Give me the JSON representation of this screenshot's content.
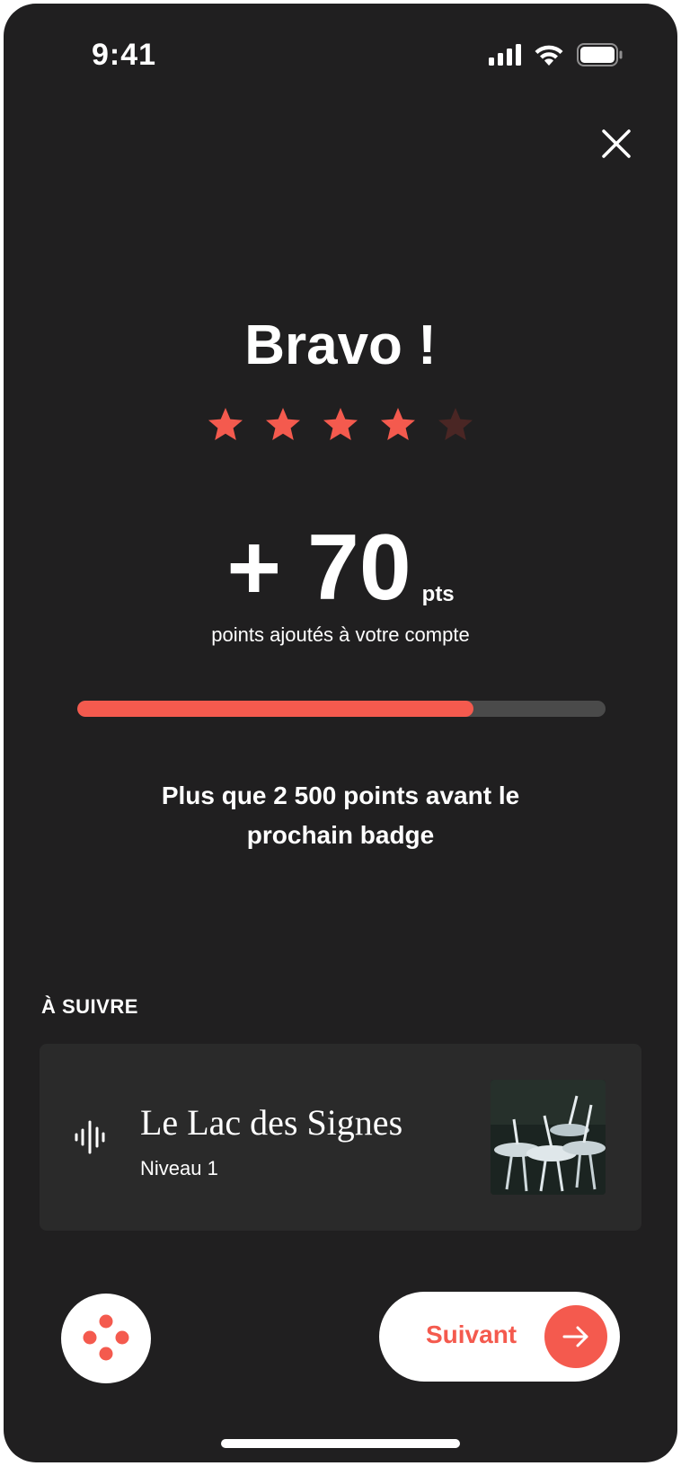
{
  "status_bar": {
    "time": "9:41",
    "icons": [
      "signal-icon",
      "wifi-icon",
      "battery-icon"
    ]
  },
  "header": {
    "close_icon": "close-icon"
  },
  "result": {
    "title": "Bravo !",
    "rating": 4,
    "rating_max": 5,
    "points_value": "+ 70",
    "points_unit": "pts",
    "points_caption": "points ajoutés à votre compte",
    "progress_fraction": 0.75,
    "next_badge_text": "Plus que 2 500 points avant le prochain badge"
  },
  "up_next": {
    "section_label": "À SUIVRE",
    "icon": "audio-wave-icon",
    "title": "Le Lac des Signes",
    "subtitle": "Niveau 1"
  },
  "footer": {
    "menu_icon": "dots-icon",
    "next_label": "Suivant",
    "next_icon": "arrow-right-icon"
  },
  "colors": {
    "background": "#201f20",
    "accent": "#f45a4e",
    "star_inactive": "#4a2624",
    "card": "#2a2a2a"
  }
}
